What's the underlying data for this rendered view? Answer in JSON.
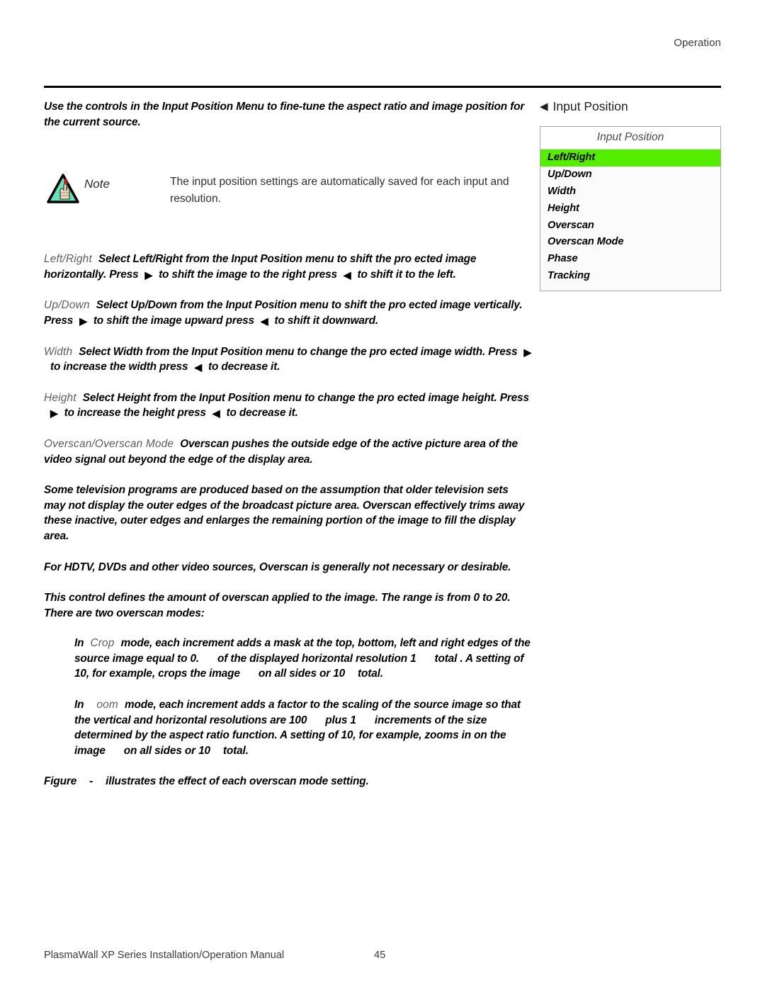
{
  "header": {
    "section": "Operation"
  },
  "footer": {
    "manual_title": "PlasmaWall XP Series Installation/Operation Manual",
    "page_number": "45"
  },
  "intro": {
    "text": "Use the controls in the Input Position Menu to fine-tune the aspect ratio and image position for the current source."
  },
  "note": {
    "icon": "note-triangle-hand-icon",
    "label": "Note",
    "text": "The input position settings are automatically saved for each input and resolution."
  },
  "paragraphs": {
    "left_right": {
      "term": "Left/Right",
      "part1": "Select Left/Right from the Input Position menu to shift the pro ected image horizontally. Press",
      "part2": "to shift the image to the right  press",
      "part3": "to shift it to the left."
    },
    "up_down": {
      "term": "Up/Down",
      "part1": "Select Up/Down from the Input Position menu to shift the pro ected image vertically. Press",
      "part2": "to shift the image upward  press",
      "part3": "to shift it downward."
    },
    "width": {
      "term": "Width",
      "part1": "Select Width from the Input Position menu to change the pro ected image width. Press",
      "part2": "to increase the width  press",
      "part3": "to decrease it."
    },
    "height": {
      "term": "Height",
      "part1": "Select Height from the Input Position menu to change the pro ected image height. Press",
      "part2": "to increase the height  press",
      "part3": "to decrease it."
    },
    "overscan": {
      "term": "Overscan/Overscan Mode",
      "text": "Overscan pushes the outside edge of the active picture area of the video signal out beyond the edge of the display area."
    },
    "overscan_explain": {
      "text": "Some television programs are produced based on the assumption that older television sets may not display the outer edges of the broadcast picture area. Overscan effectively trims away these inactive, outer edges and enlarges the remaining portion of the image to fill the display area."
    },
    "hdtv": {
      "text": "For HDTV, DVDs and other video sources, Overscan is generally not necessary or desirable."
    },
    "range": {
      "text": "This control defines the amount of overscan applied to the image. The range is from 0 to 20. There are two overscan modes:"
    },
    "crop_mode": {
      "prefix": "In",
      "term": "Crop",
      "part1": "mode, each increment adds a mask at the top, bottom, left and right edges of the source image equal to 0.",
      "part2": "of the displayed horizontal resolution  1",
      "part3": "total . A setting of 10, for example, crops the image",
      "part4": "on all sides or 10",
      "part5": "total."
    },
    "zoom_mode": {
      "prefix": "In",
      "term": "oom",
      "part1": "mode, each increment adds a factor to the scaling of the source image so that the vertical and horizontal resolutions are 100",
      "part2": "plus 1",
      "part3": "increments of the size determined by the aspect ratio function. A setting of 10, for example, zooms in on the image",
      "part4": "on all sides or 10",
      "part5": "total."
    },
    "figure_ref": {
      "prefix": "Figure",
      "dash": "-",
      "text": "illustrates the effect of each overscan mode setting."
    }
  },
  "osd": {
    "heading_arrow": "left-arrow-icon",
    "heading": "Input Position",
    "panel_title": "Input Position",
    "selected_color": "#55ee00",
    "items": [
      {
        "label": "Left/Right",
        "selected": true
      },
      {
        "label": "Up/Down",
        "selected": false
      },
      {
        "label": "Width",
        "selected": false
      },
      {
        "label": "Height",
        "selected": false
      },
      {
        "label": "Overscan",
        "selected": false
      },
      {
        "label": "Overscan Mode",
        "selected": false
      },
      {
        "label": "Phase",
        "selected": false
      },
      {
        "label": "Tracking",
        "selected": false
      }
    ]
  }
}
